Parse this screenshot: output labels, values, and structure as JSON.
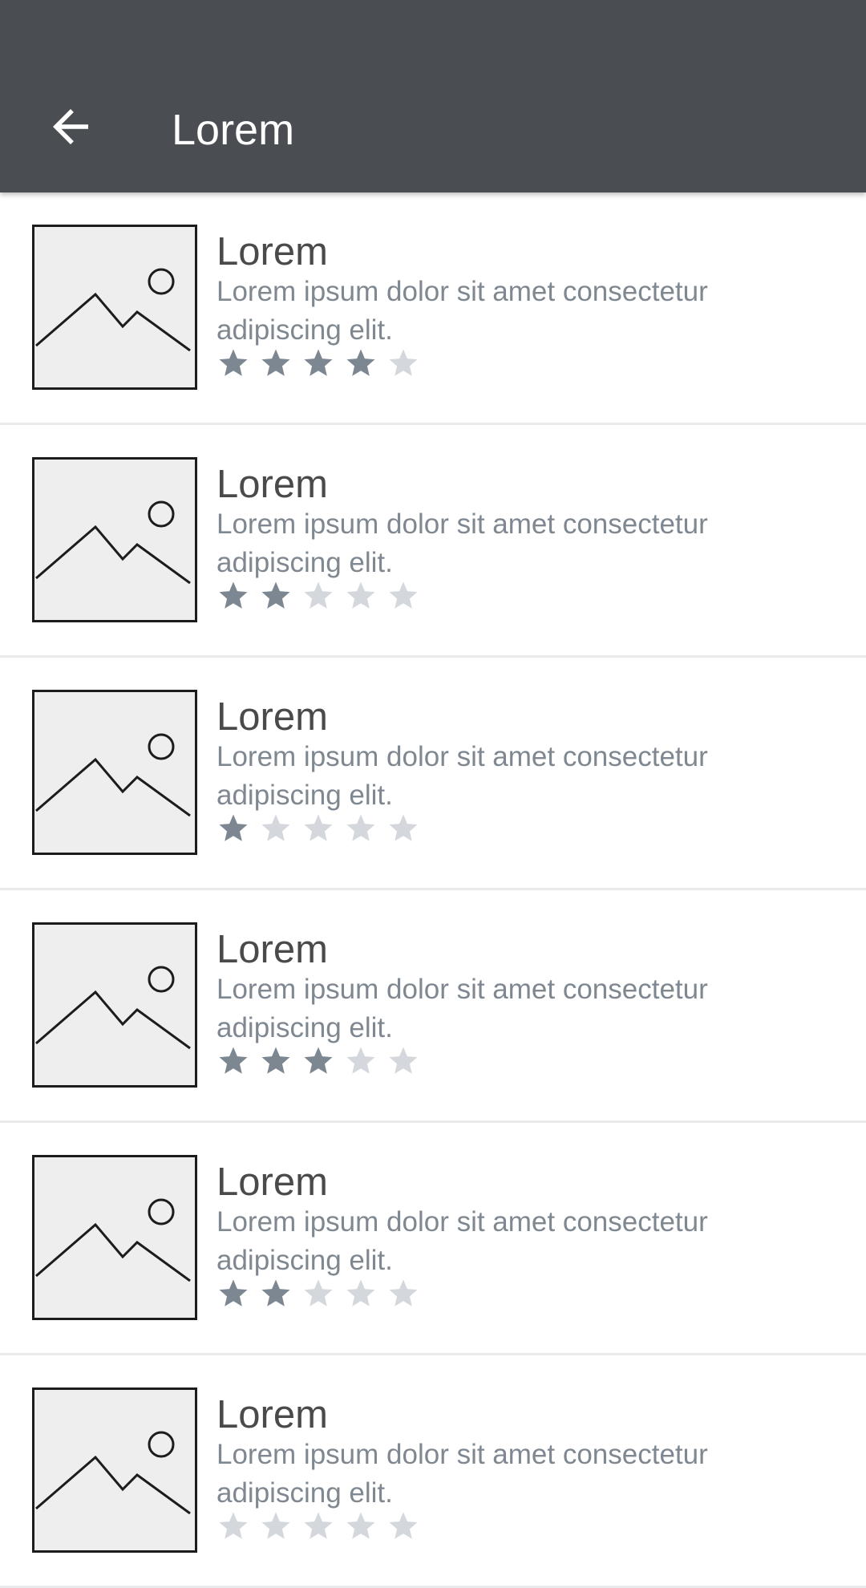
{
  "app_bar": {
    "title": "Lorem",
    "back_icon": "arrow-back-icon",
    "background_color": "#4a4e53"
  },
  "colors": {
    "star_filled": "#7d8791",
    "star_empty": "#d4d8dd",
    "title_text": "#4a4a4a",
    "description_text": "#7f8891"
  },
  "items": [
    {
      "title": "Lorem",
      "description": "Lorem ipsum dolor sit amet consectetur adipiscing elit.",
      "rating": 4,
      "max_rating": 5,
      "image_icon": "image-placeholder-icon"
    },
    {
      "title": "Lorem",
      "description": "Lorem ipsum dolor sit amet consectetur adipiscing elit.",
      "rating": 2,
      "max_rating": 5,
      "image_icon": "image-placeholder-icon"
    },
    {
      "title": "Lorem",
      "description": "Lorem ipsum dolor sit amet consectetur adipiscing elit.",
      "rating": 1,
      "max_rating": 5,
      "image_icon": "image-placeholder-icon"
    },
    {
      "title": "Lorem",
      "description": "Lorem ipsum dolor sit amet consectetur adipiscing elit.",
      "rating": 3,
      "max_rating": 5,
      "image_icon": "image-placeholder-icon"
    },
    {
      "title": "Lorem",
      "description": "Lorem ipsum dolor sit amet consectetur adipiscing elit.",
      "rating": 2,
      "max_rating": 5,
      "image_icon": "image-placeholder-icon"
    },
    {
      "title": "Lorem",
      "description": "Lorem ipsum dolor sit amet consectetur adipiscing elit.",
      "rating": 0,
      "max_rating": 5,
      "image_icon": "image-placeholder-icon"
    }
  ]
}
